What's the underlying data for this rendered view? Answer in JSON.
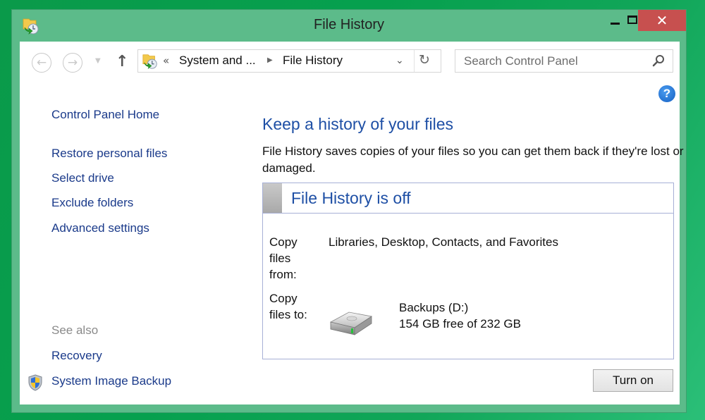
{
  "window": {
    "title": "File History",
    "controls": {
      "minimize": "minimize",
      "maximize": "maximize",
      "close": "✕"
    }
  },
  "nav": {
    "back_icon": "←",
    "forward_icon": "→",
    "recent_icon": "▼",
    "up_icon": "↑",
    "address": {
      "overflow": "«",
      "crumbs": [
        "System and ...",
        "File History"
      ],
      "separator": "▶",
      "dropdown_icon": "⌄",
      "refresh_icon": "↻"
    },
    "search": {
      "placeholder": "Search Control Panel",
      "value": ""
    }
  },
  "help_icon": "?",
  "sidebar": {
    "home": "Control Panel Home",
    "links": [
      "Restore personal files",
      "Select drive",
      "Exclude folders",
      "Advanced settings"
    ],
    "see_also_label": "See also",
    "see_also": [
      "Recovery",
      "System Image Backup"
    ]
  },
  "main": {
    "title": "Keep a history of your files",
    "description": "File History saves copies of your files so you can get them back if they're lost or damaged.",
    "status": "File History is off",
    "copy_from_label": "Copy files from:",
    "copy_from_value": "Libraries, Desktop, Contacts, and Favorites",
    "copy_to_label": "Copy files to:",
    "drive_name": "Backups (D:)",
    "drive_space": "154 GB free of 232 GB",
    "turn_on_button": "Turn on"
  }
}
